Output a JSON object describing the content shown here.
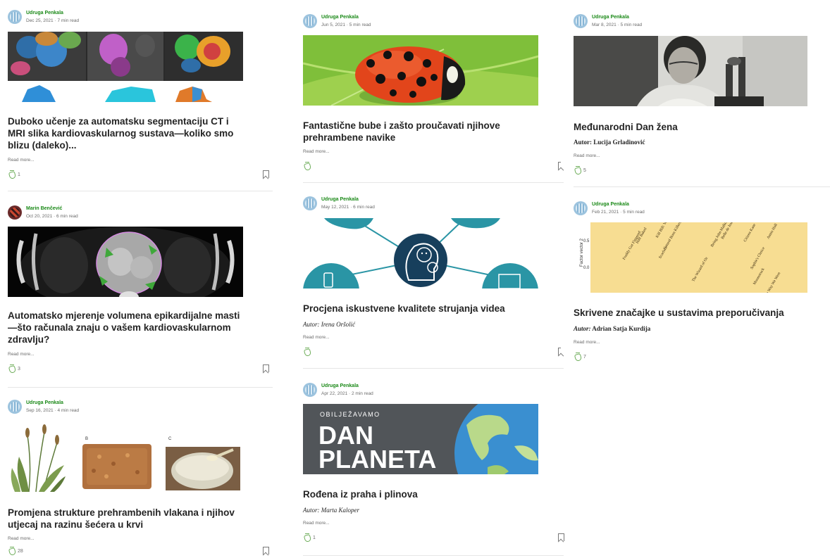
{
  "labels": {
    "read_more": "Read more..."
  },
  "colors": {
    "publication": "#1a8917",
    "meta": "#6b6b6b",
    "clap": "#6fae5b",
    "divider": "#e6e6e6"
  },
  "icons": {
    "clap": "clap-icon",
    "bookmark": "bookmark-icon",
    "avatar": "avatar"
  },
  "articles": [
    {
      "publication": "Udruga Penkala",
      "date": "Dec 25, 2021 · 7 min read",
      "title": "Duboko učenje za automatsku segmentaciju CT i MRI slika kardiovaskularnog sustava—koliko smo blizu (daleko)...",
      "author_label": "",
      "author": "",
      "claps": "1",
      "image": "ct-mri-heart-segmentation"
    },
    {
      "publication": "Marin Benčević",
      "date": "Oct 20, 2021 · 6 min read",
      "title": "Automatsko mjerenje volumena epikardijalne masti—što računala znaju o vašem kardiovaskularnom zdravlju?",
      "author_label": "",
      "author": "",
      "claps": "3",
      "image": "chest-ct-scan"
    },
    {
      "publication": "Udruga Penkala",
      "date": "Sep 16, 2021 · 4 min read",
      "title": "Promjena strukture prehrambenih vlakana i njihov utjecaj na razinu šećera u krvi",
      "author_label": "",
      "author": "",
      "claps": "28",
      "image": "plant-fiber-panels",
      "panel_labels": [
        "B",
        "C"
      ]
    },
    {
      "publication": "Udruga Penkala",
      "date": "Jun 5, 2021 · 5 min read",
      "title": "Fantastične bube i zašto proučavati njihove prehrambene navike",
      "author_label": "",
      "author": "",
      "claps": "",
      "image": "ladybug-on-leaf"
    },
    {
      "publication": "Udruga Penkala",
      "date": "May 12, 2021 · 6 min read",
      "title": "Procjena iskustvene kvalitete strujanja videa",
      "author_label": "Autor:",
      "author": "Irena Oršolić",
      "claps": "",
      "image": "video-quality-diagram"
    },
    {
      "publication": "Udruga Penkala",
      "date": "Apr 22, 2021 · 2 min read",
      "title": "Rođena iz praha i plinova",
      "author_label": "Autor:",
      "author": "Marta Kaloper",
      "claps": "1",
      "image": "dan-planeta-banner",
      "banner": {
        "kicker": "OBILJEŽAVAMO",
        "line1": "DAN",
        "line2": "PLANETA"
      }
    },
    {
      "publication": "Udruga Penkala",
      "date": "Mar 8, 2021 · 5 min read",
      "title": "Međunarodni Dan žena",
      "author_label": "Autor:",
      "author": "Lucija Grladinović",
      "claps": "5",
      "image": "woman-microscope-photo"
    },
    {
      "publication": "Udruga Penkala",
      "date": "Feb 21, 2021 · 5 min read",
      "title": "Skrivene značajke u sustavima preporučivanja",
      "author_label": "Autor:",
      "author": "Adrian Satja Kurdija",
      "claps": "7",
      "image": "movie-factor-plot",
      "plot": {
        "y_axis_label": "Factor vector 2",
        "y_ticks": [
          "0.5",
          "0.0"
        ],
        "movie_labels": [
          "Freddy Got Fingered",
          "Half Baked",
          "Kill Bill: Vol. 1",
          "Natural Born Killers",
          "Scarface",
          "The Wizard of Oz",
          "Being John Malkovich",
          "Belle de Jour",
          "Citizen Kane",
          "Annie Hall",
          "Sophie's Choice",
          "Moonstruck",
          "The Way We Were"
        ]
      }
    }
  ]
}
